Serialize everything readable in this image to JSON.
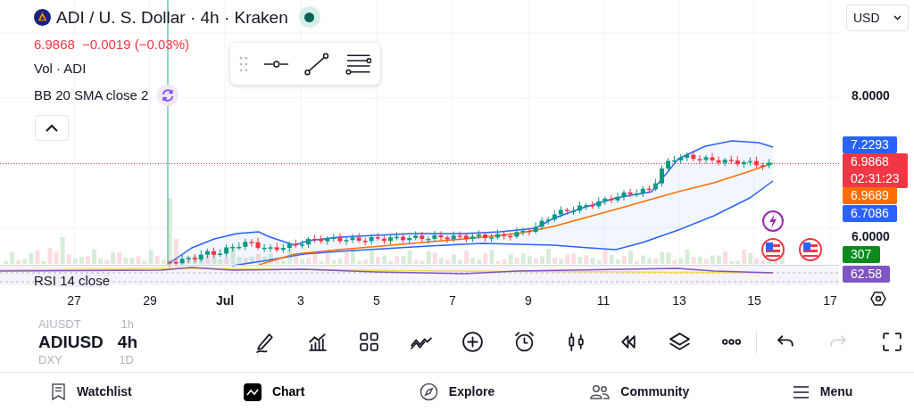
{
  "header": {
    "symbol": "ADI / U. S. Dollar · 4h · Kraken",
    "market_open": true
  },
  "quote": {
    "price": "6.9868",
    "change": "−0.0019 (−0.03%)"
  },
  "indicators": [
    "Vol · ADI",
    "BB 20 SMA close 2"
  ],
  "rsi_label": "RSI 14 close",
  "currency": "USD",
  "price_axis": {
    "ticks": [
      "8.0000",
      "6.0000"
    ],
    "labels": [
      {
        "text": "7.2293",
        "color": "#2962ff"
      },
      {
        "text": "6.9868",
        "sub": "02:31:23",
        "color": "#f23645"
      },
      {
        "text": "6.9689",
        "color": "#ff6d00"
      },
      {
        "text": "6.7086",
        "color": "#2962ff"
      },
      {
        "text": "307",
        "color": "#0b8a1e"
      },
      {
        "text": "62.58",
        "color": "#7e57c2"
      }
    ]
  },
  "date_axis": [
    {
      "label": "27",
      "bold": false
    },
    {
      "label": "29",
      "bold": false
    },
    {
      "label": "Jul",
      "bold": true
    },
    {
      "label": "3",
      "bold": false
    },
    {
      "label": "5",
      "bold": false
    },
    {
      "label": "7",
      "bold": false
    },
    {
      "label": "9",
      "bold": false
    },
    {
      "label": "11",
      "bold": false
    },
    {
      "label": "13",
      "bold": false
    },
    {
      "label": "15",
      "bold": false
    },
    {
      "label": "17",
      "bold": false
    }
  ],
  "symbols": [
    {
      "symbol": "AIUSDT",
      "interval": "1h",
      "selected": false
    },
    {
      "symbol": "ADIUSD",
      "interval": "4h",
      "selected": true
    },
    {
      "symbol": "DXY",
      "interval": "1D",
      "selected": false
    }
  ],
  "toolbar": [
    {
      "kind": "draw",
      "disabled": false
    },
    {
      "kind": "indicators",
      "disabled": false
    },
    {
      "kind": "layouts",
      "disabled": false
    },
    {
      "kind": "patterns",
      "disabled": false
    },
    {
      "kind": "add",
      "disabled": false
    },
    {
      "kind": "alert",
      "disabled": false
    },
    {
      "kind": "candles",
      "disabled": false
    },
    {
      "kind": "replay",
      "disabled": false
    },
    {
      "kind": "layers",
      "disabled": false
    },
    {
      "kind": "more",
      "disabled": false
    },
    {
      "kind": "undo",
      "disabled": false
    },
    {
      "kind": "redo",
      "disabled": true
    },
    {
      "kind": "fullscreen",
      "disabled": false
    }
  ],
  "nav": [
    {
      "label": "Watchlist",
      "kind": "watchlist",
      "selected": false
    },
    {
      "label": "Chart",
      "kind": "chart",
      "selected": true
    },
    {
      "label": "Explore",
      "kind": "explore",
      "selected": false
    },
    {
      "label": "Community",
      "kind": "community",
      "selected": false
    },
    {
      "label": "Menu",
      "kind": "menu",
      "selected": false
    }
  ]
}
